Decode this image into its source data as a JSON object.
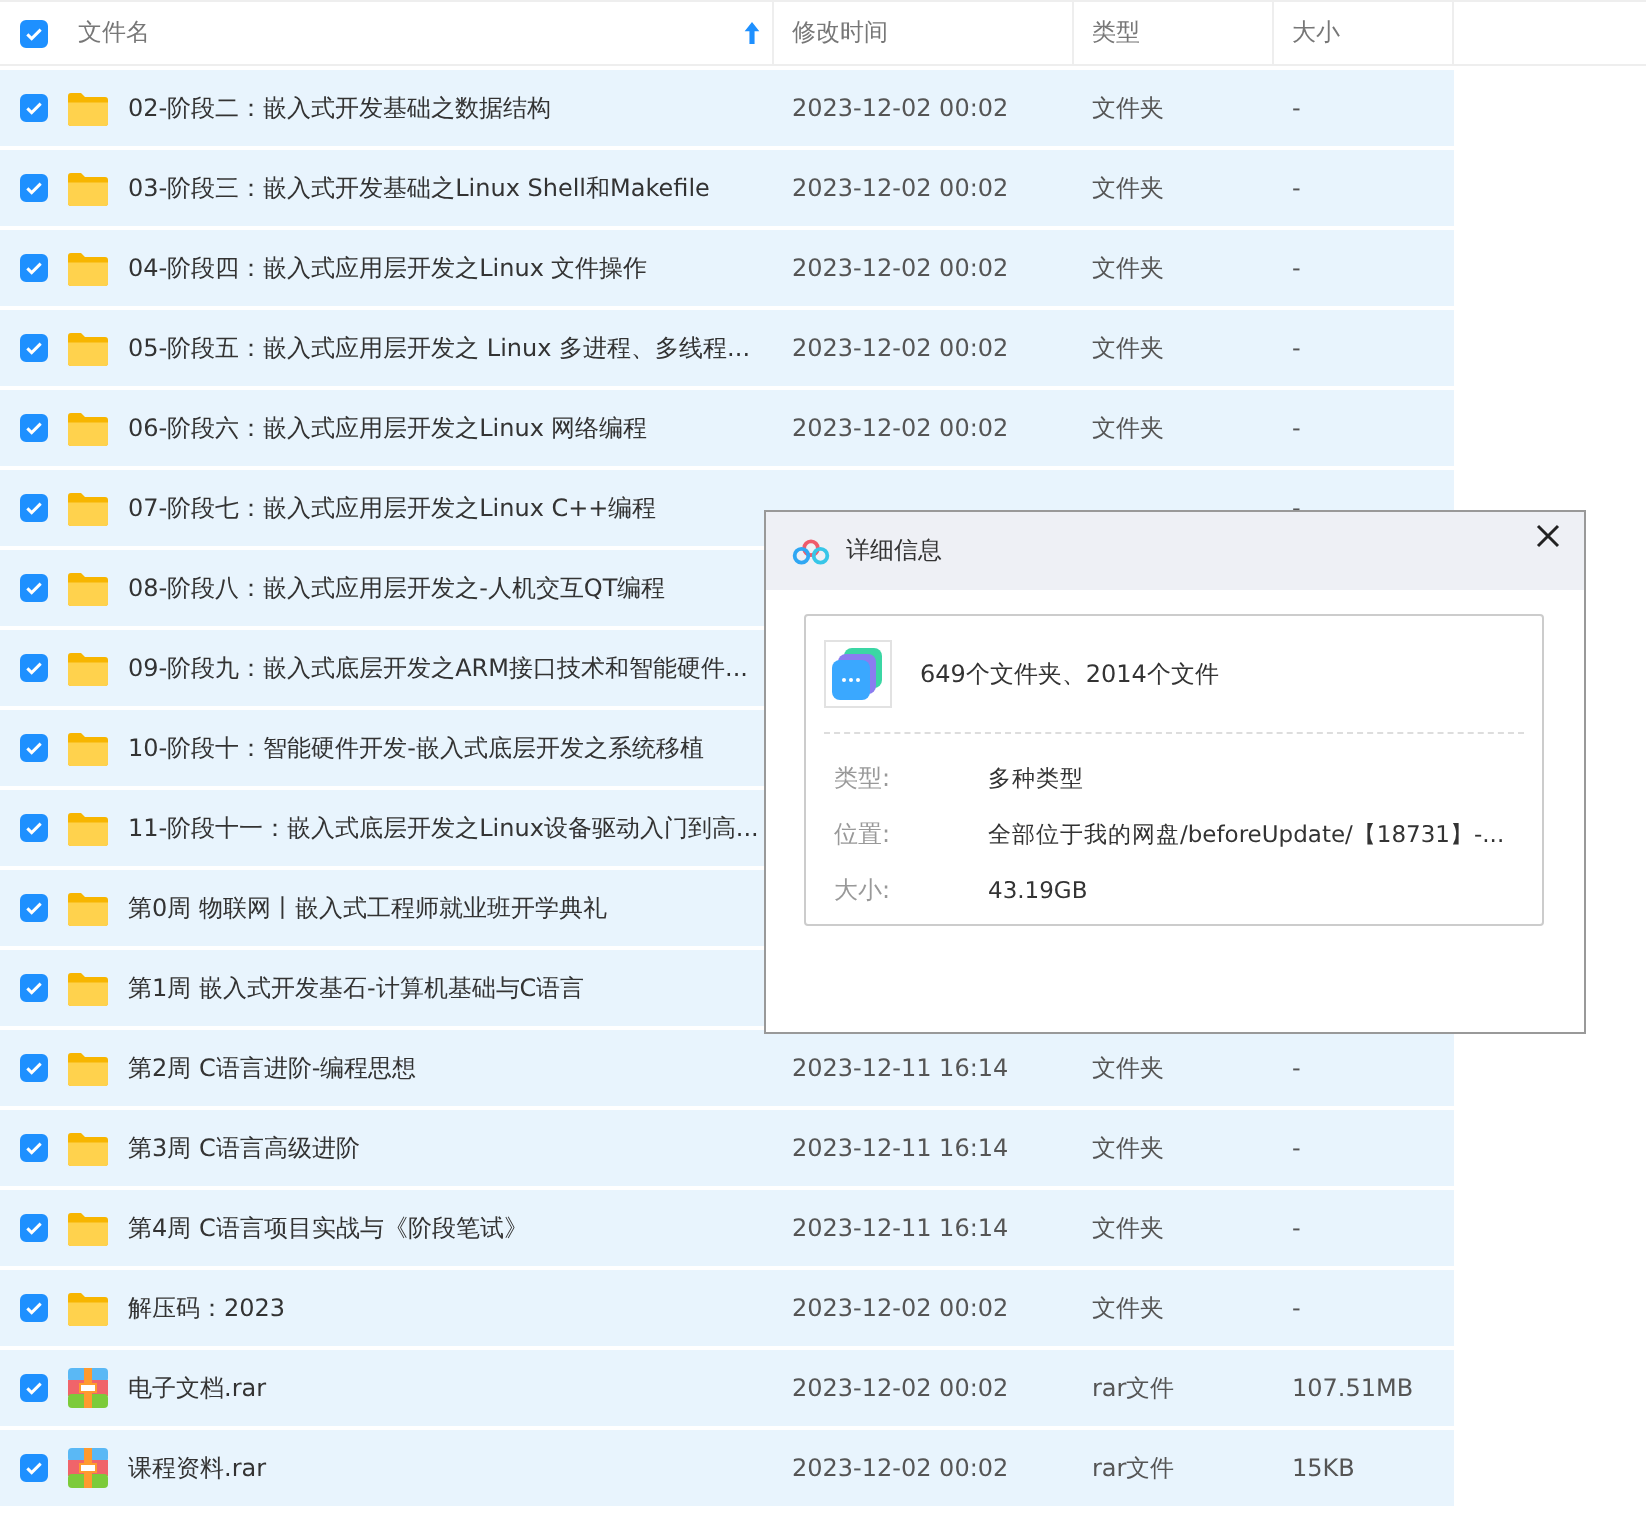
{
  "header": {
    "all_checked": true,
    "columns": [
      "文件名",
      "修改时间",
      "类型",
      "大小"
    ]
  },
  "rows": [
    {
      "kind": "folder",
      "checked": true,
      "name": "02-阶段二：嵌入式开发基础之数据结构",
      "modified": "2023-12-02 00:02",
      "type": "文件夹",
      "size": "-"
    },
    {
      "kind": "folder",
      "checked": true,
      "name": "03-阶段三：嵌入式开发基础之Linux Shell和Makefile",
      "modified": "2023-12-02 00:02",
      "type": "文件夹",
      "size": "-"
    },
    {
      "kind": "folder",
      "checked": true,
      "name": "04-阶段四：嵌入式应用层开发之Linux 文件操作",
      "modified": "2023-12-02 00:02",
      "type": "文件夹",
      "size": "-"
    },
    {
      "kind": "folder",
      "checked": true,
      "name": "05-阶段五：嵌入式应用层开发之 Linux 多进程、多线程...",
      "modified": "2023-12-02 00:02",
      "type": "文件夹",
      "size": "-"
    },
    {
      "kind": "folder",
      "checked": true,
      "name": "06-阶段六：嵌入式应用层开发之Linux 网络编程",
      "modified": "2023-12-02 00:02",
      "type": "文件夹",
      "size": "-"
    },
    {
      "kind": "folder",
      "checked": true,
      "name": "07-阶段七：嵌入式应用层开发之Linux C++编程",
      "size": "-"
    },
    {
      "kind": "folder",
      "checked": true,
      "name": "08-阶段八：嵌入式应用层开发之-人机交互QT编程"
    },
    {
      "kind": "folder",
      "checked": true,
      "name": "09-阶段九：嵌入式底层开发之ARM接口技术和智能硬件..."
    },
    {
      "kind": "folder",
      "checked": true,
      "name": "10-阶段十：智能硬件开发-嵌入式底层开发之系统移植"
    },
    {
      "kind": "folder",
      "checked": true,
      "name": "11-阶段十一：嵌入式底层开发之Linux设备驱动入门到高..."
    },
    {
      "kind": "folder",
      "checked": true,
      "name": "第0周 物联网丨嵌入式工程师就业班开学典礼"
    },
    {
      "kind": "folder",
      "checked": true,
      "name": "第1周 嵌入式开发基石-计算机基础与C语言"
    },
    {
      "kind": "folder",
      "checked": true,
      "name": "第2周 C语言进阶-编程思想",
      "modified": "2023-12-11 16:14",
      "type": "文件夹",
      "size": "-"
    },
    {
      "kind": "folder",
      "checked": true,
      "name": "第3周 C语言高级进阶",
      "modified": "2023-12-11 16:14",
      "type": "文件夹",
      "size": "-"
    },
    {
      "kind": "folder",
      "checked": true,
      "name": "第4周 C语言项目实战与《阶段笔试》",
      "modified": "2023-12-11 16:14",
      "type": "文件夹",
      "size": "-"
    },
    {
      "kind": "folder",
      "checked": true,
      "name": "解压码：2023",
      "modified": "2023-12-02 00:02",
      "type": "文件夹",
      "size": "-"
    },
    {
      "kind": "rar",
      "checked": true,
      "name": "电子文档.rar",
      "modified": "2023-12-02 00:02",
      "type": "rar文件",
      "size": "107.51MB"
    },
    {
      "kind": "rar",
      "checked": true,
      "name": "课程资料.rar",
      "modified": "2023-12-02 00:02",
      "type": "rar文件",
      "size": "15KB"
    }
  ],
  "dialog": {
    "title": "详细信息",
    "summary": "649个文件夹、2014个文件",
    "fields": [
      {
        "label": "类型:",
        "value": "多种类型"
      },
      {
        "label": "位置:",
        "value": "全部位于我的网盘/beforeUpdate/【18731】-..."
      },
      {
        "label": "大小:",
        "value": "43.19GB"
      }
    ]
  }
}
